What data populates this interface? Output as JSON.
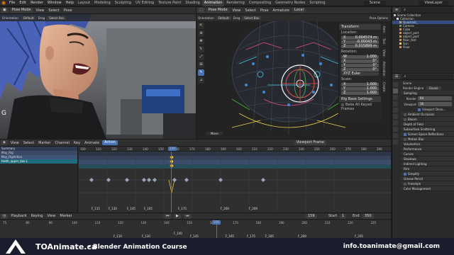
{
  "menubar": {
    "items": [
      "File",
      "Edit",
      "Render",
      "Window",
      "Help"
    ],
    "workspaces": [
      "Layout",
      "Modeling",
      "Sculpting",
      "UV Editing",
      "Texture Paint",
      "Shading",
      "Animation",
      "Rendering",
      "Compositing",
      "Geometry Nodes",
      "Scripting"
    ],
    "active_workspace": "Animation",
    "scene": "Scene",
    "view_layer": "ViewLayer"
  },
  "left_editor": {
    "mode": "Pose Mode",
    "header_items": [
      "View",
      "Select",
      "Pose"
    ],
    "orientation_label": "Orientation:",
    "orientation_value": "Default",
    "snap": "Drag",
    "select_box": "Select Box"
  },
  "viewport": {
    "mode": "Pose Mode",
    "header_items": [
      "View",
      "Select",
      "Pose",
      "Armature"
    ],
    "pivot": "Local",
    "orientation_label": "Orientation:",
    "orientation_value": "Default",
    "drag": "Drag",
    "select_box": "Select Box",
    "pose_options": "Pose Options",
    "overlay_title": "User Perspective",
    "overlay_subtitle": "(159) May_Rig : teeth_upper_ba...",
    "status": "Move",
    "npanel": {
      "transform": "Transform",
      "location": "Location:",
      "loc": [
        [
          "X",
          "0.004574 m"
        ],
        [
          "Y",
          "-0.00043 m"
        ],
        [
          "Z",
          "0.015899 m"
        ]
      ],
      "rotation": "Rotation:",
      "rot": [
        [
          "W",
          "1.000"
        ],
        [
          "X",
          "0°"
        ],
        [
          "Y",
          "0°"
        ],
        [
          "Z",
          "0°"
        ]
      ],
      "rot_mode": "XYZ Euler",
      "scale": "Scale:",
      "scl": [
        [
          "X",
          "1.000"
        ],
        [
          "Y",
          "1.000"
        ],
        [
          "Z",
          "1.000"
        ]
      ],
      "rig_base": "Rig Base Settings",
      "bake": "Bake All Keyed Frames",
      "tabs": [
        "Item",
        "Tool",
        "View",
        "Animation",
        "Create"
      ]
    }
  },
  "outliner": {
    "title": "Scene Collection",
    "items": [
      "Collection",
      "Quadrant_",
      "Camera",
      "Cube",
      "object_part",
      "object_part",
      "floor_test",
      "Sun",
      "Floor"
    ]
  },
  "properties": {
    "scene": "Scene",
    "render_engine_label": "Render Engine",
    "render_engine": "Eevee",
    "sampling": "Sampling",
    "render": "Render",
    "render_value": "64",
    "viewport": "Viewport",
    "viewport_value": "16",
    "viewport_denoise": "Viewport Deno...",
    "panels": [
      "Ambient Occlusion",
      "Bloom",
      "Depth of Field",
      "Subsurface Scattering",
      "Screen Space Reflections",
      "Motion Blur",
      "Volumetrics",
      "Performance",
      "Curves",
      "Shadows",
      "Indirect Lighting",
      "Film",
      "Simplify",
      "Grease Pencil",
      "Freestyle",
      "Color Management"
    ]
  },
  "dopesheet": {
    "header_items": [
      "View",
      "Select",
      "Marker",
      "Channel",
      "Key",
      "Animate"
    ],
    "mode": "Action",
    "action": "Viewport Frame",
    "channels": [
      {
        "label": "Summary",
        "kind": "summary"
      },
      {
        "label": "May_Rig",
        "kind": "obj"
      },
      {
        "label": "May_RigAction",
        "kind": "act"
      },
      {
        "label": "teeth_upper_bas.L",
        "kind": "bone"
      }
    ],
    "ruler": [
      "100",
      "110",
      "120",
      "130",
      "140",
      "150",
      "160",
      "170",
      "180",
      "190",
      "200",
      "210",
      "220",
      "230",
      "240",
      "250",
      "260",
      "270",
      "280",
      "290"
    ],
    "current_frame": "159",
    "markers": [
      [
        "F_115",
        18
      ],
      [
        "F_130",
        42
      ],
      [
        "F_145",
        68
      ],
      [
        "F_165",
        92
      ],
      [
        "F_175",
        99
      ],
      [
        "F_185",
        107
      ],
      [
        "F_200",
        135
      ],
      [
        "F_209",
        152
      ]
    ]
  },
  "timeline": {
    "header_items": [
      "Playback",
      "Keying",
      "View",
      "Marker"
    ],
    "current_frame": "159",
    "start_label": "Start",
    "start": "1",
    "end_label": "End",
    "end": "350",
    "ruler": [
      "75",
      "80",
      "90",
      "100",
      "110",
      "120",
      "130",
      "140",
      "150",
      "160",
      "170",
      "180",
      "190",
      "200",
      "210",
      "220",
      "225"
    ],
    "markers": [
      "F_110",
      "F_130",
      "F_140",
      "F_145",
      "F_165",
      "F_175",
      "F_185",
      "F_200",
      "F_205"
    ]
  },
  "branding": {
    "site": "TOAnimate.ca",
    "course": "- Blender Animation Course",
    "email": "info.toanimate@gmail.com"
  },
  "colors": {
    "accent": "#4772b3",
    "bone_channel": "#1f6d7c",
    "keyframe": "#e7c04b",
    "orange": "#e87d0d"
  }
}
